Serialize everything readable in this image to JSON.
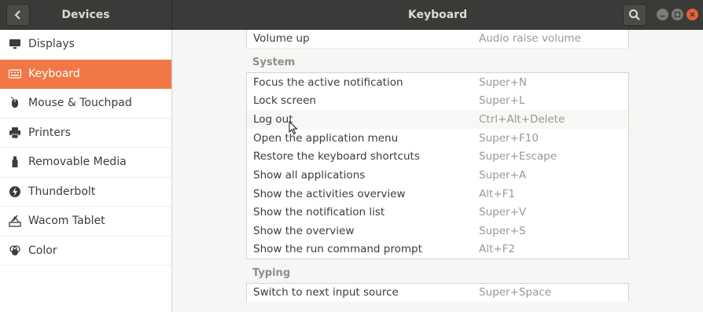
{
  "header": {
    "left_title": "Devices",
    "title": "Keyboard"
  },
  "sidebar": {
    "items": [
      {
        "label": "Displays",
        "icon": "display-icon"
      },
      {
        "label": "Keyboard",
        "icon": "keyboard-icon",
        "active": true
      },
      {
        "label": "Mouse & Touchpad",
        "icon": "mouse-icon"
      },
      {
        "label": "Printers",
        "icon": "printer-icon"
      },
      {
        "label": "Removable Media",
        "icon": "usb-drive-icon"
      },
      {
        "label": "Thunderbolt",
        "icon": "thunderbolt-icon"
      },
      {
        "label": "Wacom Tablet",
        "icon": "wacom-tablet-icon"
      },
      {
        "label": "Color",
        "icon": "color-icon"
      }
    ]
  },
  "shortcuts": {
    "top_row": {
      "name": "Volume up",
      "accel": "Audio raise volume"
    },
    "system_header": "System",
    "system": [
      {
        "name": "Focus the active notification",
        "accel": "Super+N"
      },
      {
        "name": "Lock screen",
        "accel": "Super+L"
      },
      {
        "name": "Log out",
        "accel": "Ctrl+Alt+Delete"
      },
      {
        "name": "Open the application menu",
        "accel": "Super+F10"
      },
      {
        "name": "Restore the keyboard shortcuts",
        "accel": "Super+Escape"
      },
      {
        "name": "Show all applications",
        "accel": "Super+A"
      },
      {
        "name": "Show the activities overview",
        "accel": "Alt+F1"
      },
      {
        "name": "Show the notification list",
        "accel": "Super+V"
      },
      {
        "name": "Show the overview",
        "accel": "Super+S"
      },
      {
        "name": "Show the run command prompt",
        "accel": "Alt+F2"
      }
    ],
    "typing_header": "Typing",
    "typing": [
      {
        "name": "Switch to next input source",
        "accel": "Super+Space"
      }
    ]
  },
  "colors": {
    "accent": "#f07746",
    "headerbar": "#3a3a38",
    "close_button": "#e85f34"
  }
}
